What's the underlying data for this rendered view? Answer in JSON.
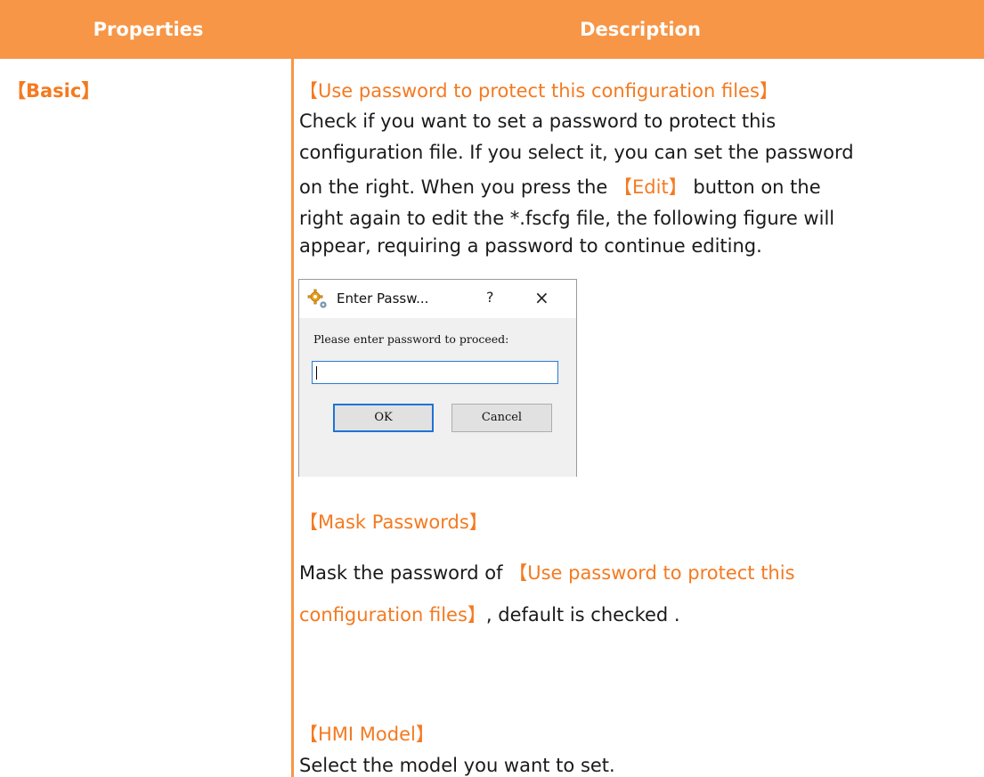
{
  "colors": {
    "header_bg": "#f79646",
    "accent": "#f47a20",
    "dialog_focus": "#1f73d4"
  },
  "table": {
    "header": {
      "properties": "Properties",
      "description": "Description"
    },
    "row_label": "【Basic】"
  },
  "sections": {
    "use_password": {
      "title": "【Use password to protect this configuration files】",
      "line1": "Check if you want to set a password to protect this",
      "line2": "configuration file. If you select it, you can set the password",
      "line3_pre": "on the right. When you press the ",
      "line3_button": "【Edit】",
      "line3_post": " button on the",
      "line4": "right again to edit the *.fscfg file, the following figure will",
      "line5": "appear, requiring a password to continue editing."
    },
    "mask_passwords": {
      "title": "【Mask Passwords】",
      "line1_pre": "Mask the password of ",
      "line1_ref": "【Use password to protect this",
      "line2_ref": "configuration files】",
      "line2_post": ", default is checked ."
    },
    "hmi_model": {
      "title": "【HMI Model】",
      "line1": "Select the model you want to set."
    }
  },
  "dialog": {
    "icon": "gear-icon",
    "title": "Enter Passw...",
    "help": "?",
    "close": "×",
    "prompt": "Please enter password to proceed:",
    "input_value": "",
    "ok_label": "OK",
    "cancel_label": "Cancel"
  }
}
